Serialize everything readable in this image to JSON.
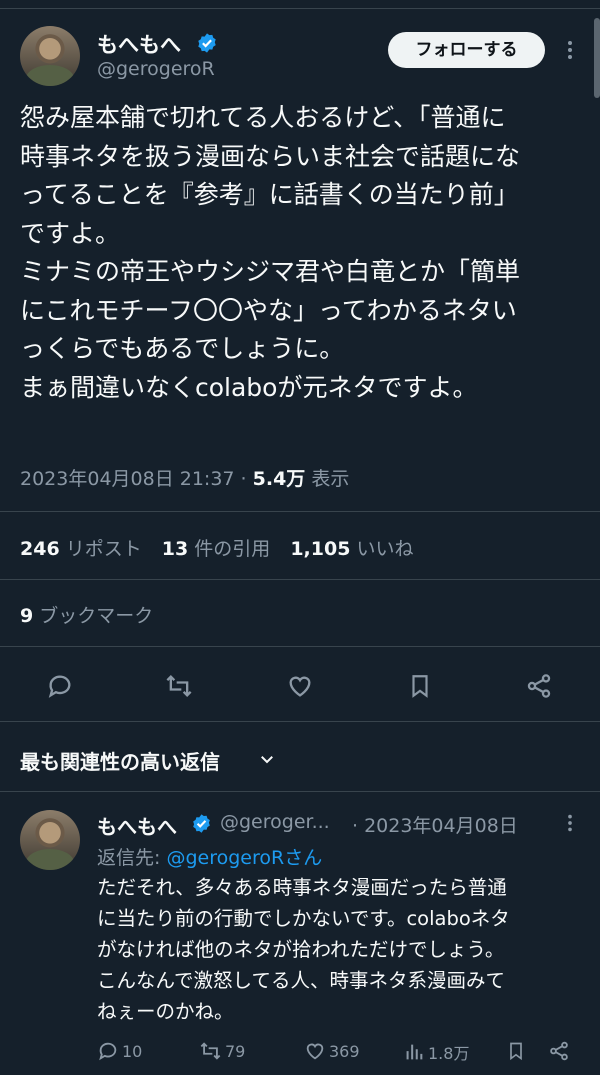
{
  "tweet": {
    "author_name": "もへもへ",
    "author_handle": "@gerogeroR",
    "follow_label": "フォローする",
    "text": "怨み屋本舗で切れてる人おるけど、「普通に\n時事ネタを扱う漫画ならいま社会で話題にな\nってることを『参考』に話書くの当たり前」\nですよ。\nミナミの帝王やウシジマ君や白竜とか「簡単\nにこれモチーフ〇〇やな」ってわかるネタい\nっくらでもあるでしょうに。\nまぁ間違いなくcolaboが元ネタですよ。",
    "timestamp": "2023年04月08日 21:37",
    "separator": " · ",
    "views_count": "5.4万",
    "views_label": " 表示",
    "reposts_count": "246",
    "reposts_label": " リポスト",
    "quotes_count": "13",
    "quotes_label": " 件の引用",
    "likes_count": "1,105",
    "likes_label": " いいね",
    "bookmarks_count": "9",
    "bookmarks_label": " ブックマーク"
  },
  "replies_section": {
    "title": "最も関連性の高い返信"
  },
  "reply": {
    "author_name": "もへもへ",
    "author_handle": "@geroger...",
    "date": "· 2023年04月08日",
    "reply_to_label": "返信先: ",
    "reply_to_handle": "@gerogeroRさん",
    "text": "ただそれ、多々ある時事ネタ漫画だったら普通\nに当たり前の行動でしかないです。colaboネタ\nがなければ他のネタが拾われただけでしょう。\nこんなんで激怒してる人、時事ネタ系漫画みて\nねぇーのかね。",
    "reply_count": "10",
    "repost_count": "79",
    "like_count": "369",
    "view_count": "1.8万"
  },
  "colors": {
    "background": "#15202b",
    "text_primary": "#f7f9f9",
    "text_secondary": "#8b98a5",
    "accent": "#1d9bf0",
    "divider": "#38444d"
  },
  "icons": [
    "verified-badge-icon",
    "more-options-icon",
    "reply-icon",
    "repost-icon",
    "like-icon",
    "bookmark-icon",
    "share-icon",
    "chevron-down-icon",
    "views-icon"
  ]
}
